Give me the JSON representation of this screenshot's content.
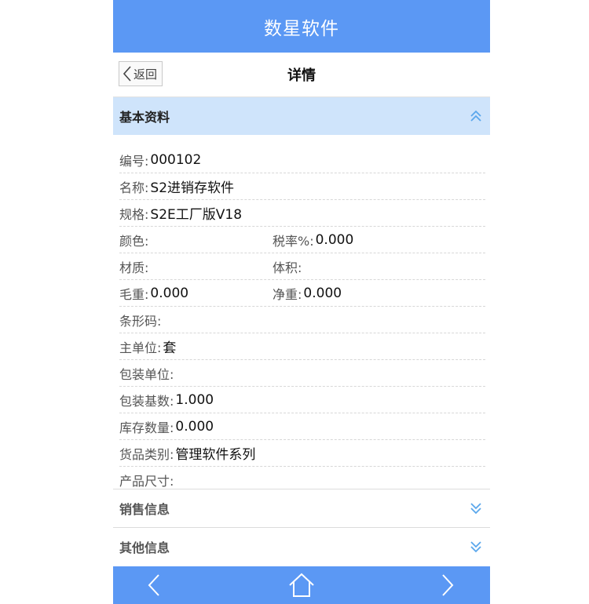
{
  "app": {
    "title": "数星软件"
  },
  "subheader": {
    "back_label": "返回",
    "title": "详情"
  },
  "sections": {
    "basic": {
      "title": "基本资料"
    },
    "sales": {
      "title": "销售信息"
    },
    "other": {
      "title": "其他信息"
    }
  },
  "details": {
    "code": {
      "label": "编号:",
      "value": "000102"
    },
    "name": {
      "label": "名称:",
      "value": "S2进销存软件"
    },
    "spec": {
      "label": "规格:",
      "value": "S2E工厂版V18"
    },
    "color": {
      "label": "颜色:",
      "value": ""
    },
    "tax_rate": {
      "label": "税率%:",
      "value": "0.000"
    },
    "material": {
      "label": "材质:",
      "value": ""
    },
    "volume": {
      "label": "体积:",
      "value": ""
    },
    "gross_weight": {
      "label": "毛重:",
      "value": "0.000"
    },
    "net_weight": {
      "label": "净重:",
      "value": "0.000"
    },
    "barcode": {
      "label": "条形码:",
      "value": ""
    },
    "main_unit": {
      "label": "主单位:",
      "value": "套"
    },
    "pack_unit": {
      "label": "包装单位:",
      "value": ""
    },
    "pack_base_qty": {
      "label": "包装基数:",
      "value": "1.000"
    },
    "stock_qty": {
      "label": "库存数量:",
      "value": "0.000"
    },
    "category": {
      "label": "货品类别:",
      "value": "管理软件系列"
    },
    "size": {
      "label": "产品尺寸:",
      "value": ""
    }
  },
  "icons": {
    "back": "chevron-left-icon",
    "collapse": "double-chevron-up-icon",
    "expand": "double-chevron-down-icon",
    "prev": "chevron-left-icon",
    "home": "home-icon",
    "next": "chevron-right-icon"
  },
  "colors": {
    "header": "#5b98f4",
    "section_active": "#cfe4fb",
    "chevron": "#5aa7ec"
  }
}
